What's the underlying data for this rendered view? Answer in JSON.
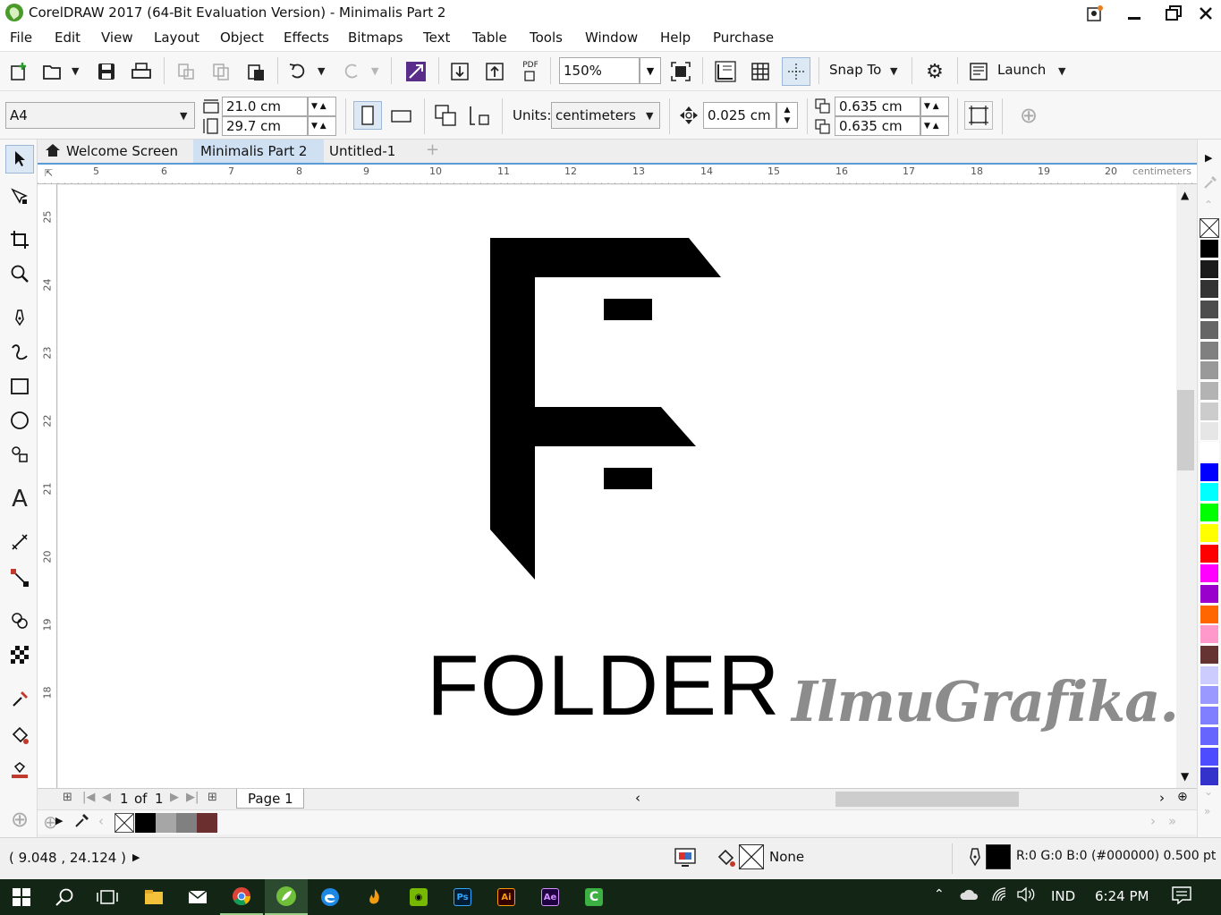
{
  "window": {
    "title": "CorelDRAW 2017 (64-Bit Evaluation Version) - Minimalis Part 2"
  },
  "menu": [
    "File",
    "Edit",
    "View",
    "Layout",
    "Object",
    "Effects",
    "Bitmaps",
    "Text",
    "Table",
    "Tools",
    "Window",
    "Help",
    "Purchase"
  ],
  "toolbar": {
    "zoom": "150%",
    "snap_label": "Snap To",
    "launch_label": "Launch",
    "pdf_label": "PDF"
  },
  "property_bar": {
    "page_size": "A4",
    "width": "21.0 cm",
    "height": "29.7 cm",
    "units_label": "Units:",
    "units": "centimeters",
    "nudge": "0.025 cm",
    "dup_x": "0.635 cm",
    "dup_y": "0.635 cm"
  },
  "tabs": [
    {
      "label": "Welcome Screen",
      "active": false
    },
    {
      "label": "Minimalis Part 2",
      "active": true
    },
    {
      "label": "Untitled-1",
      "active": false
    }
  ],
  "ruler": {
    "h_ticks": [
      "5",
      "6",
      "7",
      "8",
      "9",
      "10",
      "11",
      "12",
      "13",
      "14",
      "15",
      "16",
      "17",
      "18",
      "19",
      "20"
    ],
    "h_unit": "centimeters",
    "v_ticks": [
      "25",
      "24",
      "23",
      "22",
      "21",
      "20",
      "19",
      "18"
    ]
  },
  "canvas": {
    "logo_text": "FOLDER",
    "watermark": "IlmuGrafika.id"
  },
  "page_nav": {
    "current": "1",
    "of_label": "of",
    "total": "1",
    "page_tab": "Page 1"
  },
  "status": {
    "coords": "( 9.048 , 24.124 )",
    "fill_label": "None",
    "outline_info": "R:0 G:0 B:0 (#000000)  0.500 pt"
  },
  "colors": {
    "palette": [
      "#000000",
      "#1a1a1a",
      "#333333",
      "#4d4d4d",
      "#666666",
      "#808080",
      "#999999",
      "#b3b3b3",
      "#cccccc",
      "#e6e6e6",
      "#ffffff",
      "#0000ff",
      "#00ffff",
      "#00ff00",
      "#ffff00",
      "#ff0000",
      "#ff00ff",
      "#9900cc",
      "#ff6600",
      "#ff99cc",
      "#663333",
      "#ccccff",
      "#9999ff",
      "#7f7fff",
      "#6666ff",
      "#4d4dff",
      "#3333cc"
    ],
    "doc_palette": [
      "#000000",
      "#a6a6a6",
      "#808080",
      "#6b2f2f"
    ],
    "accent": "#5b9bd5"
  },
  "taskbar": {
    "lang": "IND",
    "time": "6:24 PM"
  }
}
